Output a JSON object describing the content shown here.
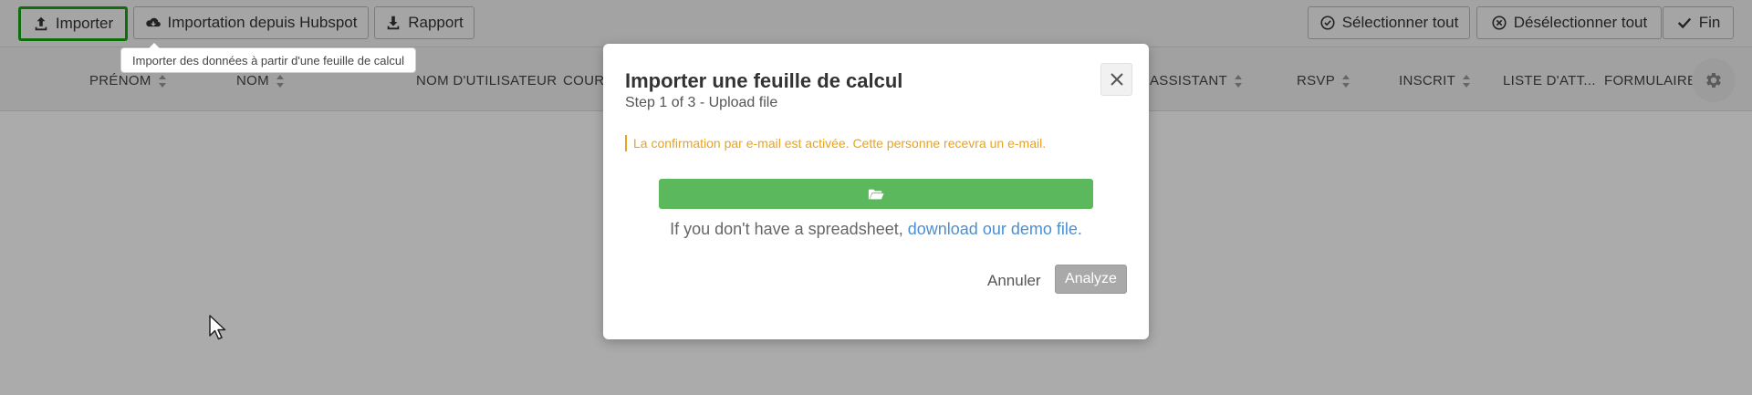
{
  "toolbar": {
    "importer_label": "Importer",
    "hubspot_label": "Importation depuis Hubspot",
    "rapport_label": "Rapport",
    "select_all_label": "Sélectionner tout",
    "deselect_all_label": "Désélectionner tout",
    "finish_label": "Fin",
    "importer_tooltip": "Importer des données à partir d'une feuille de calcul"
  },
  "table": {
    "columns": [
      {
        "label": "PRÉNOM"
      },
      {
        "label": "NOM"
      },
      {
        "label": "NOM D'UTILISATEUR"
      },
      {
        "label": "COURR"
      },
      {
        "label": "ASSISTANT"
      },
      {
        "label": "RSVP"
      },
      {
        "label": "INSCRIT"
      },
      {
        "label": "LISTE D'ATT..."
      },
      {
        "label": "FORMULAIRE"
      }
    ]
  },
  "modal": {
    "title": "Importer une feuille de calcul",
    "subtitle": "Step 1 of 3 - Upload file",
    "notice": "La confirmation par e-mail est activée. Cette personne recevra un e-mail.",
    "demo_prefix": "If you don't have a spreadsheet,",
    "demo_link": "download our demo file.",
    "cancel_label": "Annuler",
    "analyze_label": "Analyze"
  },
  "colors": {
    "highlight_border": "#16a513",
    "upload_green": "#5cb85c",
    "notice_orange": "#e8a320",
    "link_blue": "#4a8fd4",
    "analyze_disabled": "#a9a9a9"
  },
  "icons": {
    "importer": "upload-icon",
    "hubspot": "cloud-download-icon",
    "rapport": "download-icon",
    "select_all": "check-circle-icon",
    "deselect_all": "x-circle-icon",
    "finish": "check-icon",
    "settings": "gear-icon",
    "upload_bar": "folder-open-icon",
    "close": "close-icon"
  }
}
